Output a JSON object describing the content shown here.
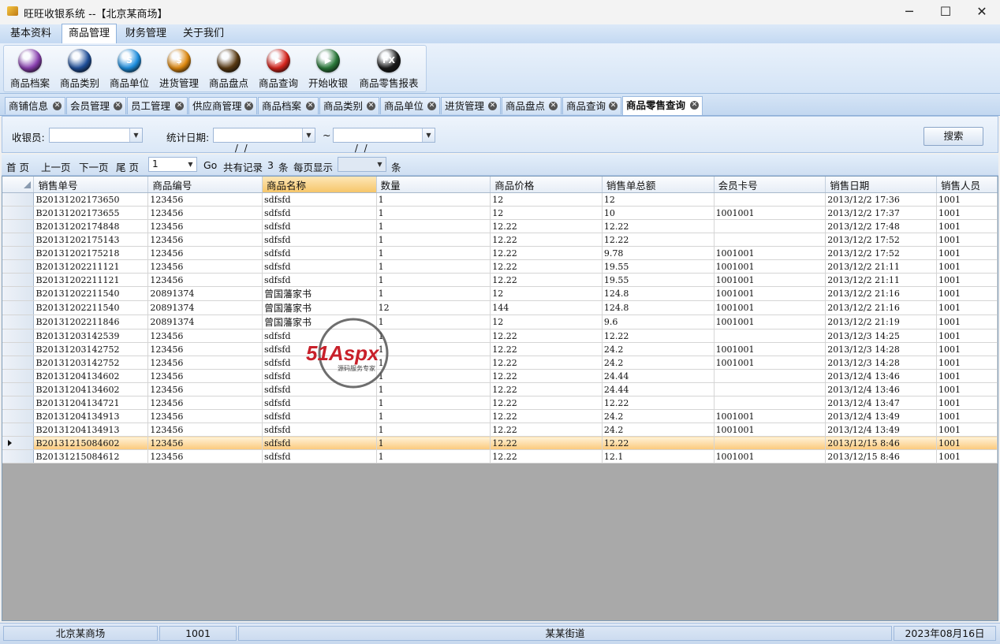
{
  "window": {
    "title": "旺旺收银系统 --【北京某商场】",
    "minimize": "─",
    "maximize": "☐",
    "close": "✕"
  },
  "menu": [
    "基本资料",
    "商品管理",
    "财务管理",
    "关于我们"
  ],
  "menu_active": "商品管理",
  "ribbon": [
    {
      "label": "商品档案",
      "icon": "product-archive-icon",
      "color": "#8a3fb0"
    },
    {
      "label": "商品类别",
      "icon": "product-category-icon",
      "color": "#1f4f9a"
    },
    {
      "label": "商品单位",
      "icon": "skype-like-unit-icon",
      "color": "#1d8fe0",
      "glyph": "S"
    },
    {
      "label": "进货管理",
      "icon": "purchase-icon",
      "color": "#e08a10",
      "glyph": "$"
    },
    {
      "label": "商品盘点",
      "icon": "inventory-icon",
      "color": "#5a3a12"
    },
    {
      "label": "商品查询",
      "icon": "youtube-like-query-icon",
      "color": "#d8241c",
      "glyph": "▶"
    },
    {
      "label": "开始收银",
      "icon": "play-cashier-icon",
      "color": "#2a7a3a",
      "glyph": "▶"
    },
    {
      "label": "商品零售报表",
      "icon": "fx-report-icon",
      "color": "#1a1a1a",
      "glyph": "FX"
    }
  ],
  "tabs": [
    "商铺信息",
    "会员管理",
    "员工管理",
    "供应商管理",
    "商品档案",
    "商品类别",
    "商品单位",
    "进货管理",
    "商品盘点",
    "商品查询",
    "商品零售查询"
  ],
  "tab_active": "商品零售查询",
  "filter": {
    "cashier_label": "收银员:",
    "cashier_value": "",
    "date_label": "统计日期:",
    "date_from": "  /  /",
    "tilde": "~",
    "date_to": "  /  /",
    "search_button": "搜索"
  },
  "pager": {
    "first": "首 页",
    "prev": "上一页",
    "next": "下一页",
    "last": "尾 页",
    "page_value": "1",
    "go": "Go",
    "total_prefix": "共有记录",
    "total_count": "3",
    "total_suffix": "条",
    "per_page_label": "每页显示",
    "per_page_value": "",
    "per_page_suffix": "条"
  },
  "grid": {
    "columns": [
      "销售单号",
      "商品编号",
      "商品名称",
      "数量",
      "商品价格",
      "销售单总额",
      "会员卡号",
      "销售日期",
      "销售人员"
    ],
    "selected_column": "商品名称",
    "current_row_index": 18,
    "rows": [
      [
        "B20131202173650",
        "123456",
        "sdfsfd",
        "1",
        "12",
        "12",
        "",
        "2013/12/2 17:36",
        "1001"
      ],
      [
        "B20131202173655",
        "123456",
        "sdfsfd",
        "1",
        "12",
        "10",
        "1001001",
        "2013/12/2 17:37",
        "1001"
      ],
      [
        "B20131202174848",
        "123456",
        "sdfsfd",
        "1",
        "12.22",
        "12.22",
        "",
        "2013/12/2 17:48",
        "1001"
      ],
      [
        "B20131202175143",
        "123456",
        "sdfsfd",
        "1",
        "12.22",
        "12.22",
        "",
        "2013/12/2 17:52",
        "1001"
      ],
      [
        "B20131202175218",
        "123456",
        "sdfsfd",
        "1",
        "12.22",
        "9.78",
        "1001001",
        "2013/12/2 17:52",
        "1001"
      ],
      [
        "B20131202211121",
        "123456",
        "sdfsfd",
        "1",
        "12.22",
        "19.55",
        "1001001",
        "2013/12/2 21:11",
        "1001"
      ],
      [
        "B20131202211121",
        "123456",
        "sdfsfd",
        "1",
        "12.22",
        "19.55",
        "1001001",
        "2013/12/2 21:11",
        "1001"
      ],
      [
        "B20131202211540",
        "20891374",
        "曾国藩家书",
        "1",
        "12",
        "124.8",
        "1001001",
        "2013/12/2 21:16",
        "1001"
      ],
      [
        "B20131202211540",
        "20891374",
        "曾国藩家书",
        "12",
        "144",
        "124.8",
        "1001001",
        "2013/12/2 21:16",
        "1001"
      ],
      [
        "B20131202211846",
        "20891374",
        "曾国藩家书",
        "1",
        "12",
        "9.6",
        "1001001",
        "2013/12/2 21:19",
        "1001"
      ],
      [
        "B20131203142539",
        "123456",
        "sdfsfd",
        "1",
        "12.22",
        "12.22",
        "",
        "2013/12/3 14:25",
        "1001"
      ],
      [
        "B20131203142752",
        "123456",
        "sdfsfd",
        "1",
        "12.22",
        "24.2",
        "1001001",
        "2013/12/3 14:28",
        "1001"
      ],
      [
        "B20131203142752",
        "123456",
        "sdfsfd",
        "1",
        "12.22",
        "24.2",
        "1001001",
        "2013/12/3 14:28",
        "1001"
      ],
      [
        "B20131204134602",
        "123456",
        "sdfsfd",
        "1",
        "12.22",
        "24.44",
        "",
        "2013/12/4 13:46",
        "1001"
      ],
      [
        "B20131204134602",
        "123456",
        "sdfsfd",
        "1",
        "12.22",
        "24.44",
        "",
        "2013/12/4 13:46",
        "1001"
      ],
      [
        "B20131204134721",
        "123456",
        "sdfsfd",
        "1",
        "12.22",
        "12.22",
        "",
        "2013/12/4 13:47",
        "1001"
      ],
      [
        "B20131204134913",
        "123456",
        "sdfsfd",
        "1",
        "12.22",
        "24.2",
        "1001001",
        "2013/12/4 13:49",
        "1001"
      ],
      [
        "B20131204134913",
        "123456",
        "sdfsfd",
        "1",
        "12.22",
        "24.2",
        "1001001",
        "2013/12/4 13:49",
        "1001"
      ],
      [
        "B20131215084602",
        "123456",
        "sdfsfd",
        "1",
        "12.22",
        "12.22",
        "",
        "2013/12/15 8:46",
        "1001"
      ],
      [
        "B20131215084612",
        "123456",
        "sdfsfd",
        "1",
        "12.22",
        "12.1",
        "1001001",
        "2013/12/15 8:46",
        "1001"
      ]
    ]
  },
  "watermark": {
    "brand": "51Aspx",
    "tagline": "源码服务专家"
  },
  "status": {
    "store": "北京某商场",
    "user": "1001",
    "address": "某某街道",
    "date": "2023年08月16日"
  }
}
